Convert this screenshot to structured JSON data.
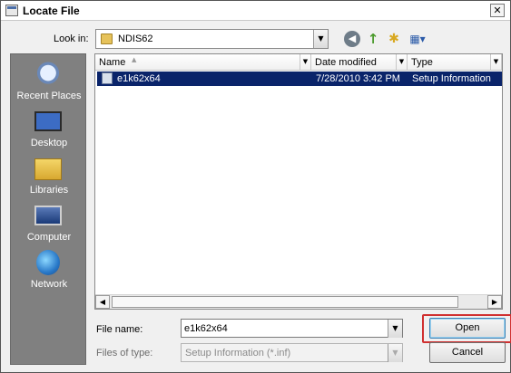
{
  "window": {
    "title": "Locate File",
    "close_glyph": "✕",
    "icon": "app-window-icon"
  },
  "toolbar": {
    "look_in_label": "Look in:",
    "look_in_value": "NDIS62",
    "folder_icon": "folder-icon",
    "back_icon": "back-arrow-icon",
    "up_icon": "up-folder-icon",
    "new_folder_icon": "new-folder-icon",
    "views_icon": "views-menu-icon"
  },
  "places": [
    {
      "label": "Recent Places",
      "icon": "recent-places-icon"
    },
    {
      "label": "Desktop",
      "icon": "desktop-icon"
    },
    {
      "label": "Libraries",
      "icon": "libraries-icon"
    },
    {
      "label": "Computer",
      "icon": "computer-icon"
    },
    {
      "label": "Network",
      "icon": "network-icon"
    }
  ],
  "file_list": {
    "columns": [
      "Name",
      "Date modified",
      "Type"
    ],
    "rows": [
      {
        "name": "e1k62x64",
        "date_modified": "7/28/2010 3:42 PM",
        "type": "Setup Information",
        "selected": true
      }
    ]
  },
  "footer": {
    "file_name_label": "File name:",
    "file_name_value": "e1k62x64",
    "files_of_type_label": "Files of type:",
    "files_of_type_value": "Setup Information (*.inf)",
    "open_label": "Open",
    "cancel_label": "Cancel"
  },
  "colors": {
    "selection": "#0a246a",
    "places_bg": "#808080",
    "highlight_box": "#d03030"
  }
}
